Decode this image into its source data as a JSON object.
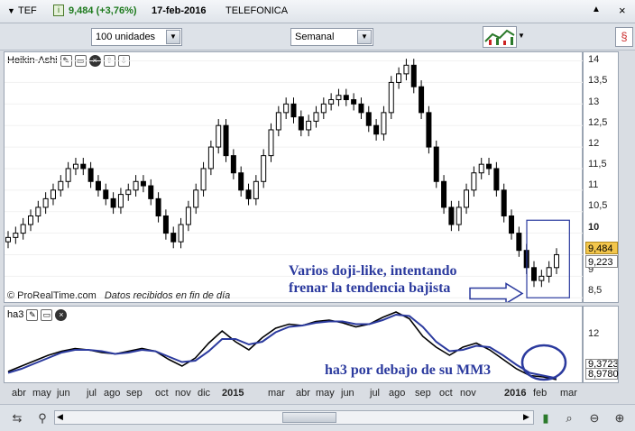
{
  "titlebar": {
    "menu_arrow": "▼",
    "symbol": "TEF",
    "price_change": "9,484 (+3,76%)",
    "date": "17-feb-2016",
    "name": "TELEFONICA"
  },
  "toolbar": {
    "units_value": "100 unidades",
    "period_value": "Semanal"
  },
  "price_panel": {
    "title": "Heikin-Ashi",
    "watermark": "© ProRealTime.com",
    "data_note": "Datos recibidos en fin de día",
    "y_labels": [
      "14",
      "13,5",
      "13",
      "12,5",
      "12",
      "11,5",
      "11",
      "10,5",
      "10",
      "9,5",
      "9",
      "8,5"
    ],
    "current_price": "9,484",
    "second_price": "9,223",
    "annotation_line1": "Varios doji-like, intentando",
    "annotation_line2": "frenar la tendencia bajista"
  },
  "indicator_panel": {
    "title": "ha3",
    "y_label": "12",
    "value1": "9,3723",
    "value2": "8,9780",
    "annotation": "ha3 por debajo de su MM3"
  },
  "x_axis": {
    "labels": [
      "abr",
      "may",
      "jun",
      "jul",
      "ago",
      "sep",
      "oct",
      "nov",
      "dic",
      "2015",
      "mar",
      "abr",
      "may",
      "jun",
      "jul",
      "ago",
      "sep",
      "oct",
      "nov",
      "2016",
      "feb",
      "mar"
    ]
  },
  "colors": {
    "bull_candle": "#ffffff",
    "bear_candle": "#000000",
    "ha3_line": "#000000",
    "mm3_line": "#2b3a9e",
    "annotation": "#2b3a9e",
    "price_highlight": "#f3c64b"
  },
  "chart_data": {
    "type": "candlestick",
    "title": "",
    "close_series_approx": [
      9.9,
      10.0,
      10.2,
      10.4,
      10.6,
      10.8,
      11.0,
      11.2,
      11.5,
      11.6,
      11.5,
      11.2,
      11.0,
      10.8,
      10.6,
      10.9,
      11.0,
      11.2,
      11.1,
      10.8,
      10.4,
      10.0,
      9.8,
      10.2,
      10.6,
      11.0,
      11.5,
      12.0,
      12.5,
      11.8,
      11.4,
      11.0,
      10.8,
      11.2,
      11.8,
      12.4,
      12.8,
      13.0,
      12.7,
      12.4,
      12.6,
      12.8,
      13.0,
      13.1,
      13.2,
      13.1,
      13.0,
      12.8,
      12.5,
      12.3,
      12.8,
      13.5,
      13.7,
      13.9,
      13.4,
      12.8,
      12.0,
      11.2,
      10.6,
      10.2,
      10.6,
      11.0,
      11.4,
      11.6,
      11.5,
      11.0,
      10.4,
      10.0,
      9.6,
      9.2,
      8.9,
      9.0,
      9.2,
      9.5
    ],
    "ylim": [
      8.4,
      14.2
    ],
    "indicators": [
      {
        "name": "ha3",
        "values": [
          9.4,
          9.8,
          10.2,
          10.6,
          10.9,
          11.1,
          11.0,
          10.8,
          10.7,
          10.9,
          11.1,
          10.9,
          10.3,
          9.8,
          10.4,
          11.5,
          12.4,
          11.6,
          11.0,
          11.9,
          12.6,
          12.9,
          12.8,
          13.1,
          13.2,
          13.0,
          12.7,
          12.9,
          13.4,
          13.8,
          13.3,
          12.0,
          11.2,
          10.6,
          11.2,
          11.5,
          11.0,
          10.3,
          9.6,
          9.1,
          9.0,
          8.8
        ]
      },
      {
        "name": "MM3",
        "values": [
          9.3,
          9.6,
          10.0,
          10.4,
          10.8,
          11.0,
          11.0,
          10.9,
          10.7,
          10.8,
          11.0,
          10.9,
          10.5,
          10.1,
          10.2,
          10.9,
          11.8,
          11.8,
          11.4,
          11.6,
          12.3,
          12.7,
          12.8,
          13.0,
          13.1,
          13.1,
          12.9,
          12.9,
          13.2,
          13.6,
          13.5,
          12.7,
          11.6,
          10.9,
          11.0,
          11.3,
          11.2,
          10.6,
          9.9,
          9.3,
          9.1,
          8.9
        ]
      }
    ]
  }
}
